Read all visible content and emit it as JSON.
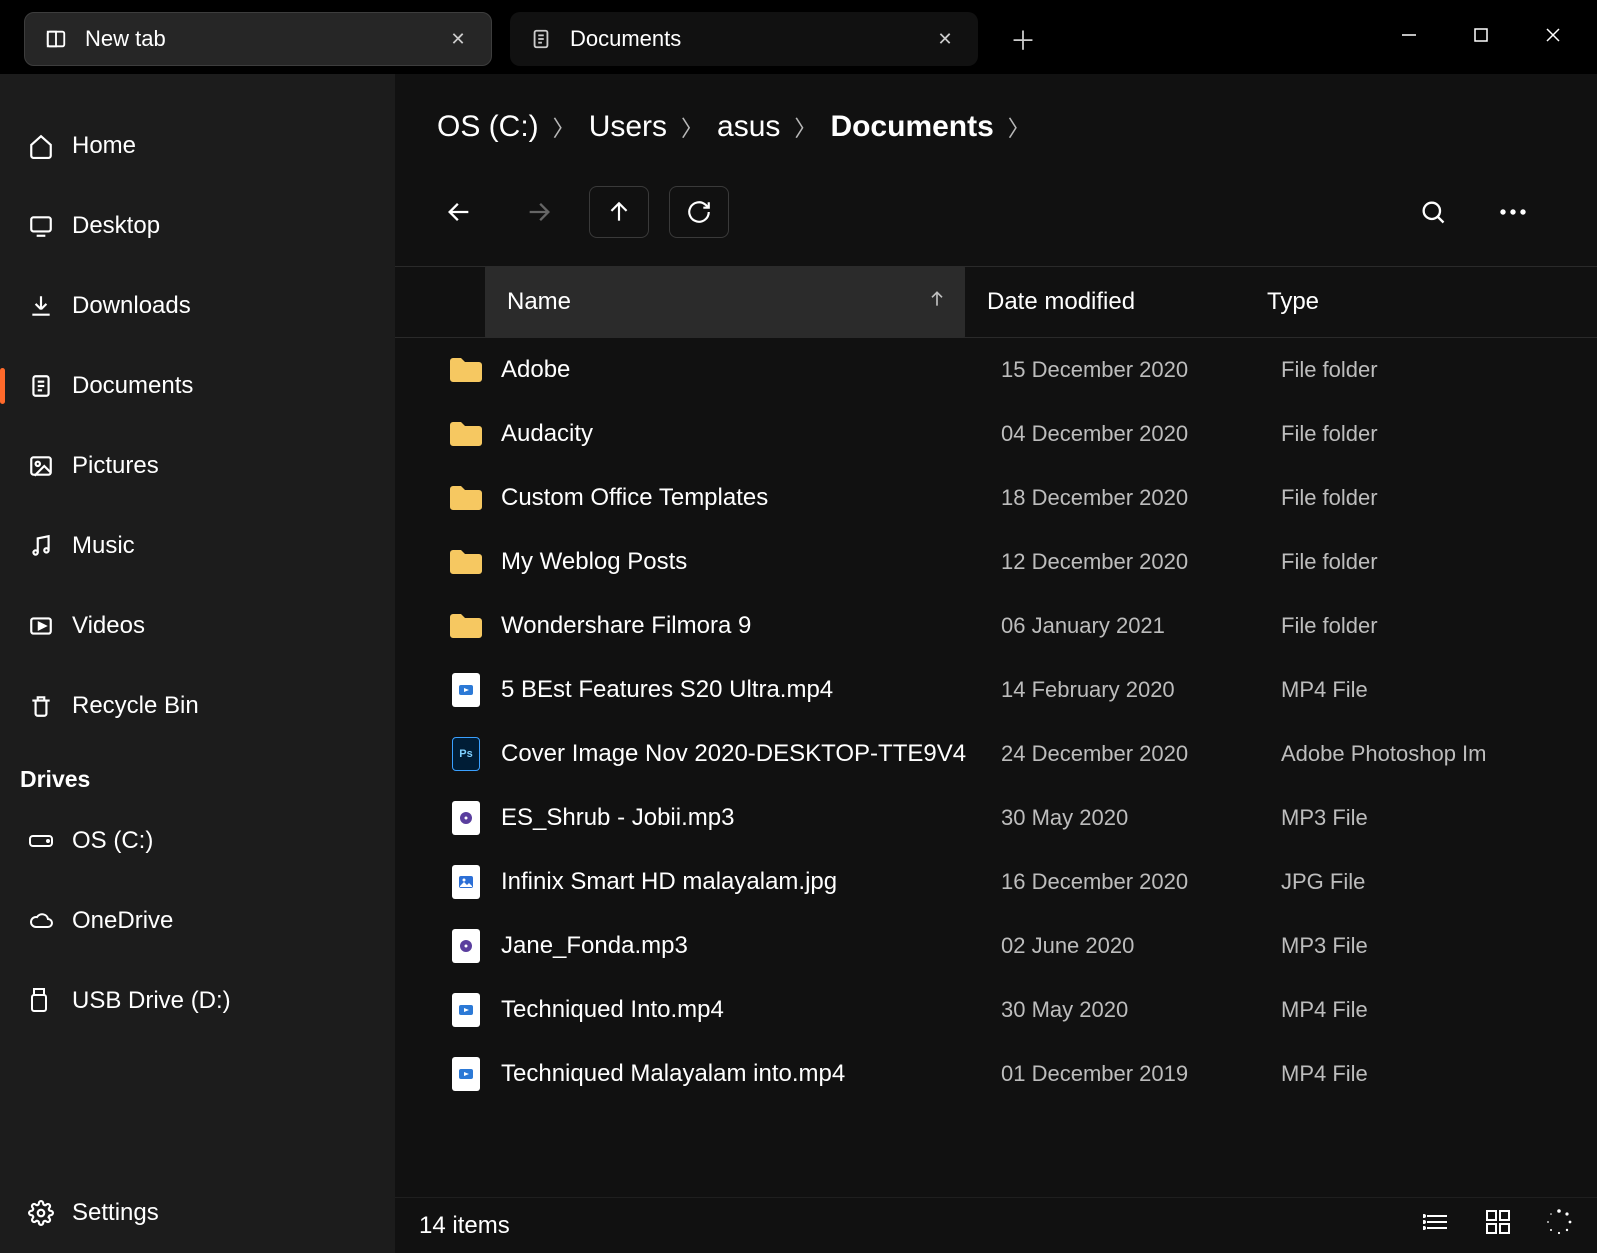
{
  "titlebar": {
    "tabs": [
      {
        "label": "New tab",
        "icon": "newtab"
      },
      {
        "label": "Documents",
        "icon": "doc"
      }
    ]
  },
  "sidebar": {
    "items": [
      {
        "label": "Home",
        "icon": "home"
      },
      {
        "label": "Desktop",
        "icon": "monitor"
      },
      {
        "label": "Downloads",
        "icon": "download"
      },
      {
        "label": "Documents",
        "icon": "doc"
      },
      {
        "label": "Pictures",
        "icon": "image"
      },
      {
        "label": "Music",
        "icon": "music"
      },
      {
        "label": "Videos",
        "icon": "video"
      },
      {
        "label": "Recycle Bin",
        "icon": "trash"
      }
    ],
    "drives_header": "Drives",
    "drives": [
      {
        "label": "OS (C:)",
        "icon": "disk"
      },
      {
        "label": "OneDrive",
        "icon": "cloud"
      },
      {
        "label": "USB Drive (D:)",
        "icon": "usb"
      }
    ],
    "settings_label": "Settings"
  },
  "breadcrumb": {
    "parts": [
      "OS (C:)",
      "Users",
      "asus",
      "Documents"
    ]
  },
  "columns": {
    "name": "Name",
    "date": "Date modified",
    "type": "Type"
  },
  "files": [
    {
      "icon": "folder",
      "name": "Adobe",
      "date": "15 December 2020",
      "type": "File folder"
    },
    {
      "icon": "folder",
      "name": "Audacity",
      "date": "04 December 2020",
      "type": "File folder"
    },
    {
      "icon": "folder",
      "name": "Custom Office Templates",
      "date": "18 December 2020",
      "type": "File folder"
    },
    {
      "icon": "folder",
      "name": "My Weblog Posts",
      "date": "12 December 2020",
      "type": "File folder"
    },
    {
      "icon": "folder",
      "name": "Wondershare Filmora 9",
      "date": "06 January 2021",
      "type": "File folder"
    },
    {
      "icon": "mp4",
      "name": "5 BEst Features S20 Ultra.mp4",
      "date": "14 February 2020",
      "type": "MP4 File"
    },
    {
      "icon": "psd",
      "name": "Cover Image Nov 2020-DESKTOP-TTE9V4",
      "date": "24 December 2020",
      "type": "Adobe Photoshop Im"
    },
    {
      "icon": "mp3",
      "name": "ES_Shrub - Jobii.mp3",
      "date": "30 May 2020",
      "type": "MP3 File"
    },
    {
      "icon": "jpg",
      "name": "Infinix Smart HD malayalam.jpg",
      "date": "16 December 2020",
      "type": "JPG File"
    },
    {
      "icon": "mp3",
      "name": "Jane_Fonda.mp3",
      "date": "02 June 2020",
      "type": "MP3 File"
    },
    {
      "icon": "mp4",
      "name": "Techniqued Into.mp4",
      "date": "30 May 2020",
      "type": "MP4 File"
    },
    {
      "icon": "mp4",
      "name": "Techniqued Malayalam into.mp4",
      "date": "01 December 2019",
      "type": "MP4 File"
    }
  ],
  "status": {
    "count": "14 items"
  }
}
